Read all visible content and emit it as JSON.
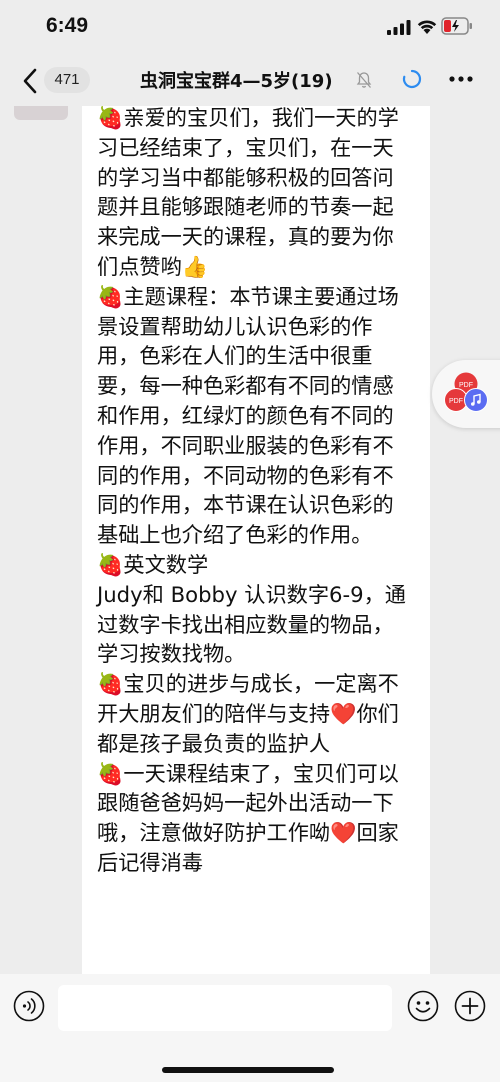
{
  "status_bar": {
    "time": "6:49"
  },
  "nav": {
    "unread_count": "471",
    "title": "虫洞宝宝群4—5岁(19)"
  },
  "message": {
    "lines": [
      "🍓亲爱的宝贝们，我们一天的学习已经结束了，宝贝们，在一天的学习当中都能够积极的回答问题并且能够跟随老师的节奏一起来完成一天的课程，真的要为你们点赞哟👍",
      "🍓主题课程：本节课主要通过场景设置帮助幼儿认识色彩的作用，色彩在人们的生活中很重要，每一种色彩都有不同的情感和作用，红绿灯的颜色有不同的作用，不同职业服装的色彩有不同的作用，不同动物的色彩有不同的作用，本节课在认识色彩的基础上也介绍了色彩的作用。",
      "🍓英文数学",
      "Judy和 Bobby 认识数字6-9，通过数字卡找出相应数量的物品，学习按数找物。",
      "🍓宝贝的进步与成长，一定离不开大朋友们的陪伴与支持❤️你们都是孩子最负责的监护人",
      "🍓一天课程结束了，宝贝们可以跟随爸爸妈妈一起外出活动一下哦，注意做好防护工作呦❤️回家后记得消毒"
    ]
  },
  "float_pill": {
    "icon_left_label": "PDF",
    "icon_right_label": "PDF"
  },
  "input": {
    "placeholder": "",
    "value": ""
  },
  "colors": {
    "background": "#ededed",
    "bubble": "#ffffff",
    "strawberry": "#c8232c",
    "heart": "#e0242b"
  }
}
